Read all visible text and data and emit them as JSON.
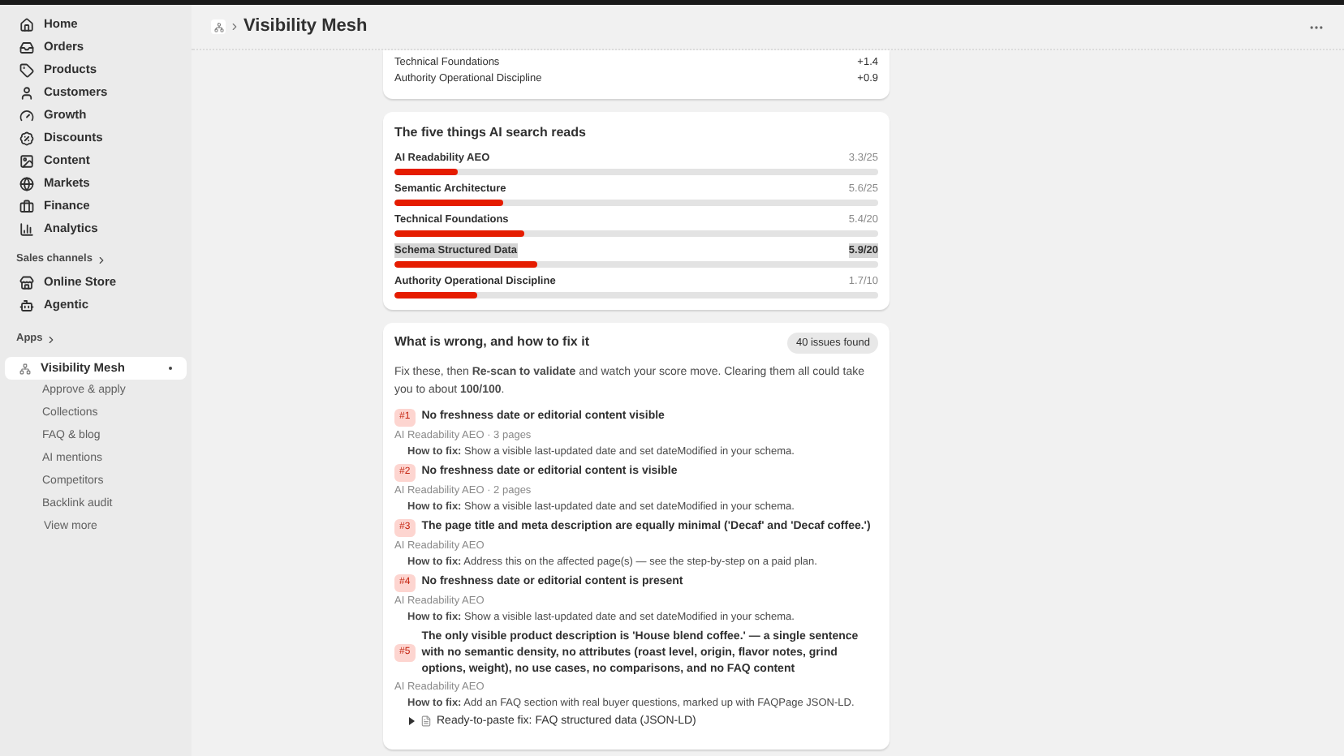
{
  "sidebar": {
    "items": [
      {
        "label": "Home"
      },
      {
        "label": "Orders"
      },
      {
        "label": "Products"
      },
      {
        "label": "Customers"
      },
      {
        "label": "Growth"
      },
      {
        "label": "Discounts"
      },
      {
        "label": "Content"
      },
      {
        "label": "Markets"
      },
      {
        "label": "Finance"
      },
      {
        "label": "Analytics"
      }
    ],
    "sales_channels": {
      "heading": "Sales channels",
      "items": [
        {
          "label": "Online Store"
        },
        {
          "label": "Agentic"
        }
      ]
    },
    "apps": {
      "heading": "Apps",
      "app": {
        "label": "Visibility Mesh",
        "selected": true
      },
      "sub_items": [
        "Approve & apply",
        "Collections",
        "FAQ & blog",
        "AI mentions",
        "Competitors",
        "Backlink audit"
      ],
      "more": "View more"
    }
  },
  "header": {
    "title": "Visibility Mesh"
  },
  "uplift_card": {
    "rows": [
      {
        "label": "Technical Foundations",
        "value": "+1.4"
      },
      {
        "label": "Authority Operational Discipline",
        "value": "+0.9"
      }
    ]
  },
  "pillars_card": {
    "title": "The five things AI search reads",
    "rows": [
      {
        "label": "AI Readability AEO",
        "score": "3.3/25",
        "level": 0.132,
        "selected": false
      },
      {
        "label": "Semantic Architecture",
        "score": "5.6/25",
        "level": 0.224,
        "selected": false
      },
      {
        "label": "Technical Foundations",
        "score": "5.4/20",
        "level": 0.27,
        "selected": false
      },
      {
        "label": "Schema Structured Data",
        "score": "5.9/20",
        "level": 0.295,
        "selected": true
      },
      {
        "label": "Authority Operational Discipline",
        "score": "1.7/10",
        "level": 0.17,
        "selected": false
      }
    ]
  },
  "issues_card": {
    "title": "What is wrong, and how to fix it",
    "count": "40 issues found",
    "intro": "Fix these, then **Re-scan to validate** and watch your score move. Clearing them all could take you to about **100/100**.",
    "issues": [
      {
        "number": "#1",
        "title": "No freshness date or editorial content visible",
        "meta": "AI Readability AEO · 3 pages",
        "fix": "**How to fix:** Show a visible last-updated date and set dateModified in your schema."
      },
      {
        "number": "#2",
        "title": "No freshness date or editorial content is visible",
        "meta": "AI Readability AEO · 2 pages",
        "fix": "**How to fix:** Show a visible last-updated date and set dateModified in your schema."
      },
      {
        "number": "#3",
        "title": "The page title and meta description are equally minimal ('Decaf' and 'Decaf coffee.')",
        "meta": "AI Readability AEO",
        "fix": "**How to fix:** Address this on the affected page(s) — see the step-by-step on a paid plan."
      },
      {
        "number": "#4",
        "title": "No freshness date or editorial content is present",
        "meta": "AI Readability AEO",
        "fix": "**How to fix:** Show a visible last-updated date and set dateModified in your schema."
      },
      {
        "number": "#5",
        "title": "The only visible product description is 'House blend coffee.' — a single sentence with no semantic density, no attributes (roast level, origin, flavor notes, grind options, weight), no use cases, no comparisons, and no FAQ content",
        "meta": "AI Readability AEO",
        "fix": "**How to fix:** Add an FAQ section with real buyer questions, marked up with FAQPage JSON-LD.",
        "snippet": {
          "label": "Ready-to-paste fix: FAQ structured data (JSON-LD)",
          "expanded": false
        }
      }
    ]
  }
}
